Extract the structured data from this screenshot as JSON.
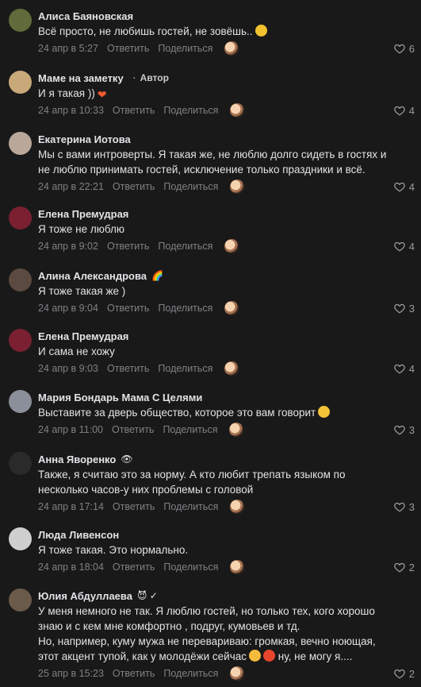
{
  "share_label": "Поделиться",
  "reply_label": "Ответить",
  "comments": [
    {
      "author": "Алиса Баяновская",
      "tag": "",
      "badge": "",
      "lines": [
        "Всё просто, не любишь гостей, не зовёшь.."
      ],
      "date": "24 апр в 5:27",
      "likes": "6",
      "avatar_color": "#5f6b3a",
      "emoji": "emo-think"
    },
    {
      "author": "Маме на заметку",
      "tag": "Автор",
      "badge": "",
      "lines": [
        "И я такая ))"
      ],
      "date": "24 апр в 10:33",
      "likes": "4",
      "avatar_color": "#c9a87a",
      "emoji": "emo-heart"
    },
    {
      "author": "Екатерина Иотова",
      "tag": "",
      "badge": "",
      "lines": [
        "Мы с вами интроверты. Я такая же, не люблю долго сидеть в гостях и",
        "не люблю принимать гостей, исключение только праздники и всё."
      ],
      "date": "24 апр в 22:21",
      "likes": "4",
      "avatar_color": "#b9a89a",
      "emoji": ""
    },
    {
      "author": "Елена Премудрая",
      "tag": "",
      "badge": "",
      "lines": [
        "Я тоже не люблю"
      ],
      "date": "24 апр в 9:02",
      "likes": "4",
      "avatar_color": "#7a2030",
      "emoji": ""
    },
    {
      "author": "Алина Александрова",
      "tag": "",
      "badge": "🌈",
      "lines": [
        "Я тоже такая же )"
      ],
      "date": "24 апр в 9:04",
      "likes": "3",
      "avatar_color": "#5a4a40",
      "emoji": ""
    },
    {
      "author": "Елена Премудрая",
      "tag": "",
      "badge": "",
      "lines": [
        "И сама не хожу"
      ],
      "date": "24 апр в 9:03",
      "likes": "4",
      "avatar_color": "#7a2030",
      "emoji": ""
    },
    {
      "author": "Мария Бондарь Мама С Целями",
      "tag": "",
      "badge": "",
      "lines": [
        "Выставите за дверь общество, которое это вам говорит"
      ],
      "date": "24 апр в 11:00",
      "likes": "3",
      "avatar_color": "#8a8f9a",
      "emoji": "emo-laugh"
    },
    {
      "author": "Анна Яворенко",
      "tag": "",
      "badge": "👁",
      "lines": [
        "Также, я считаю это за норму. А кто любит трепать языком по",
        "несколько часов-у них проблемы с головой"
      ],
      "date": "24 апр в 17:14",
      "likes": "3",
      "avatar_color": "#2a2a2a",
      "emoji": ""
    },
    {
      "author": "Люда Ливенсон",
      "tag": "",
      "badge": "",
      "lines": [
        "Я тоже такая. Это нормально."
      ],
      "date": "24 апр в 18:04",
      "likes": "2",
      "avatar_color": "#cfcfcf",
      "emoji": ""
    },
    {
      "author": "Юлия Абдуллаева",
      "tag": "",
      "badge": "😈 ✓",
      "lines": [
        "У меня немного не так. Я люблю гостей, но только тех, кого хорошо",
        "знаю и с кем мне комфортно , подруг, кумовьев и тд.",
        "Но, например, куму мужа не перевариваю: громкая, вечно ноющая,",
        "этот акцент тупой, как у молодёжи сейчас    ну, не могу я...."
      ],
      "date": "25 апр в 15:23",
      "likes": "2",
      "avatar_color": "#6a5a4a",
      "emoji": ""
    }
  ]
}
